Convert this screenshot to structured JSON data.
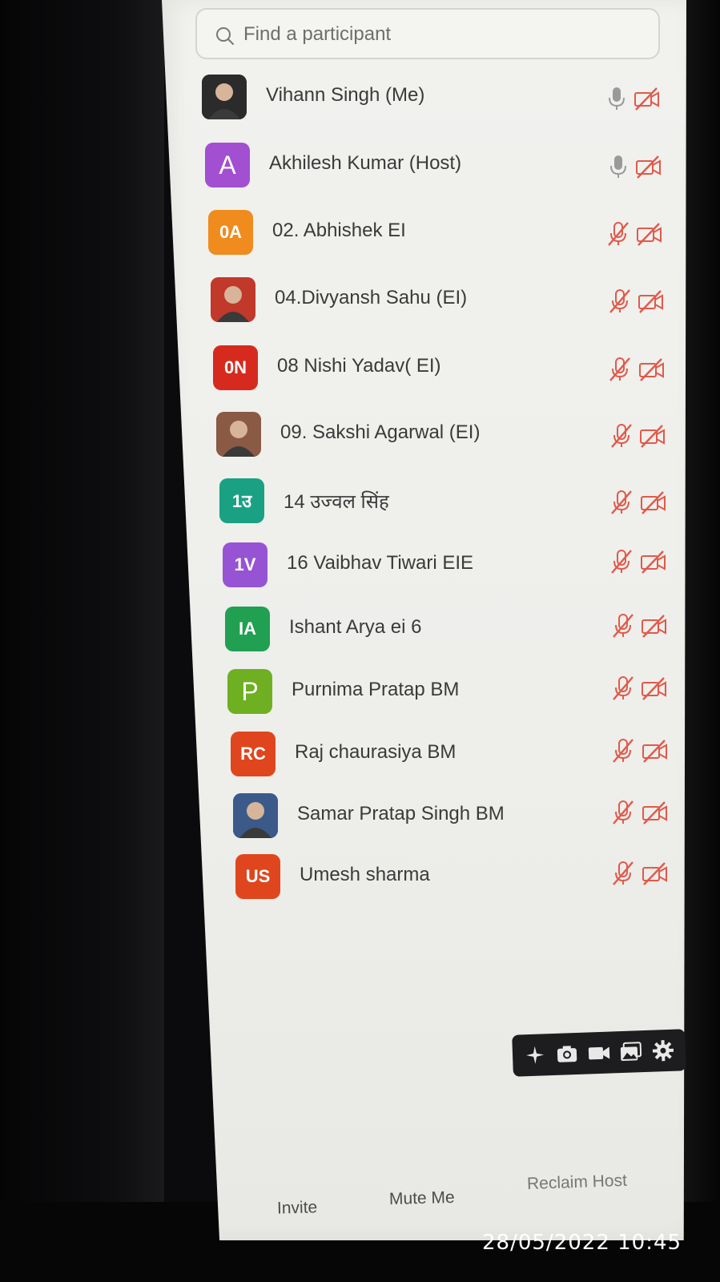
{
  "search": {
    "placeholder": "Find a participant"
  },
  "participants": [
    {
      "name": "Vihann Singh (Me)",
      "avatar_text": "",
      "avatar_color": "#2b2b2b",
      "photo": true,
      "mic": "on",
      "video": "off"
    },
    {
      "name": "Akhilesh Kumar (Host)",
      "avatar_text": "A",
      "avatar_color": "#a24fd1",
      "photo": false,
      "mic": "on",
      "video": "off"
    },
    {
      "name": "02. Abhishek EI",
      "avatar_text": "0A",
      "avatar_color": "#ef8c1d",
      "photo": false,
      "mic": "muted",
      "video": "off"
    },
    {
      "name": "04.Divyansh Sahu (EI)",
      "avatar_text": "",
      "avatar_color": "#c0392b",
      "photo": true,
      "mic": "muted",
      "video": "off"
    },
    {
      "name": "08 Nishi Yadav( EI)",
      "avatar_text": "0N",
      "avatar_color": "#d62a1e",
      "photo": false,
      "mic": "muted",
      "video": "off"
    },
    {
      "name": "09. Sakshi Agarwal (EI)",
      "avatar_text": "",
      "avatar_color": "#8a5a44",
      "photo": true,
      "mic": "muted",
      "video": "off"
    },
    {
      "name": "14 उज्वल सिंह",
      "avatar_text": "1उ",
      "avatar_color": "#1aa184",
      "photo": false,
      "mic": "muted",
      "video": "off"
    },
    {
      "name": "16 Vaibhav Tiwari EIE",
      "avatar_text": "1V",
      "avatar_color": "#9653d3",
      "photo": false,
      "mic": "muted",
      "video": "off"
    },
    {
      "name": "Ishant Arya ei 6",
      "avatar_text": "IA",
      "avatar_color": "#20a050",
      "photo": false,
      "mic": "muted",
      "video": "off"
    },
    {
      "name": "Purnima Pratap BM",
      "avatar_text": "P",
      "avatar_color": "#6fb022",
      "photo": false,
      "mic": "muted",
      "video": "off"
    },
    {
      "name": "Raj chaurasiya BM",
      "avatar_text": "RC",
      "avatar_color": "#e0461e",
      "photo": false,
      "mic": "muted",
      "video": "off"
    },
    {
      "name": "Samar Pratap Singh BM",
      "avatar_text": "",
      "avatar_color": "#3b5a8a",
      "photo": true,
      "mic": "muted",
      "video": "off"
    },
    {
      "name": "Umesh sharma",
      "avatar_text": "US",
      "avatar_color": "#e0461e",
      "photo": false,
      "mic": "muted",
      "video": "off"
    }
  ],
  "toolbar": {
    "icons": [
      "sparkle-icon",
      "camera-icon",
      "video-camera-icon",
      "gallery-icon",
      "gear-icon"
    ]
  },
  "footer": {
    "invite": "Invite",
    "mute_me": "Mute Me",
    "reclaim_host": "Reclaim Host"
  },
  "timestamp": "28/05/2022 10:45",
  "colors": {
    "muted_icon": "#e05a4a",
    "active_mic": "#9a9a9a"
  }
}
